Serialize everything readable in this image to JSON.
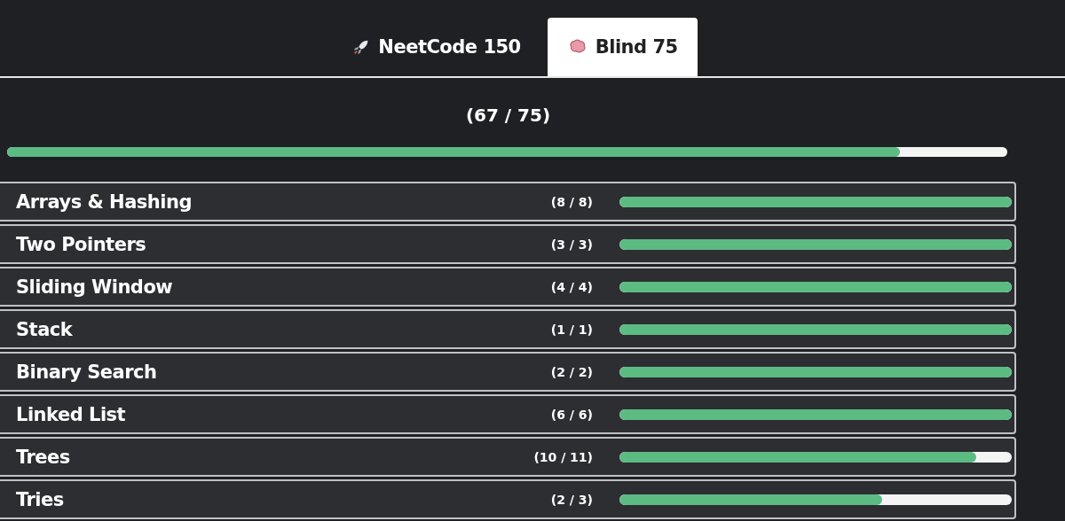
{
  "tabs": [
    {
      "label": "NeetCode 150",
      "selected": false
    },
    {
      "label": "Blind 75",
      "selected": true
    }
  ],
  "overall": {
    "count": "(67 / 75)",
    "level": 0.893
  },
  "topics": [
    {
      "name": "Arrays & Hashing",
      "count": "(8 / 8)",
      "level": 1
    },
    {
      "name": "Two Pointers",
      "count": "(3 / 3)",
      "level": 1
    },
    {
      "name": "Sliding Window",
      "count": "(4 / 4)",
      "level": 1
    },
    {
      "name": "Stack",
      "count": "(1 / 1)",
      "level": 1
    },
    {
      "name": "Binary Search",
      "count": "(2 / 2)",
      "level": 1
    },
    {
      "name": "Linked List",
      "count": "(6 / 6)",
      "level": 1
    },
    {
      "name": "Trees",
      "count": "(10 / 11)",
      "level": 0.91
    },
    {
      "name": "Tries",
      "count": "(2 / 3)",
      "level": 0.67
    }
  ]
}
